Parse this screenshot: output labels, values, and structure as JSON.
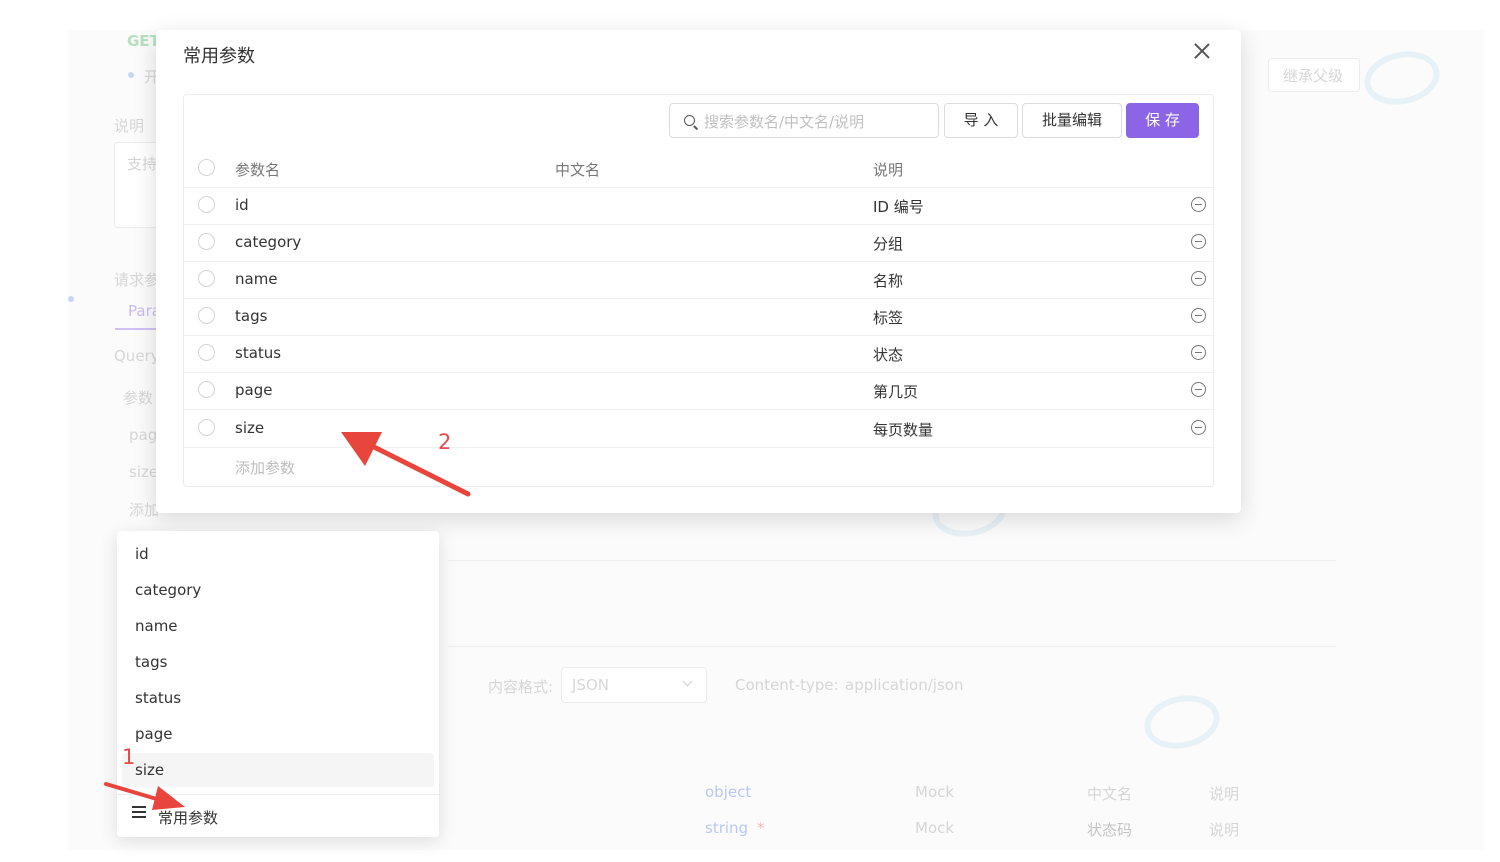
{
  "background": {
    "method": "GET",
    "status_text": "开",
    "description_label": "说明",
    "description_placeholder": "支持",
    "inherit_label": "继承父级",
    "request_params_label": "请求参",
    "params_tab": "Para",
    "query_label": "Query",
    "param_label": "参数",
    "rows": [
      "pag",
      "size",
      "添加"
    ],
    "content_format_label": "内容格式:",
    "content_format_value": "JSON",
    "content_type_label": "Content-type:",
    "content_type_value": "application/json",
    "schema_rows": [
      {
        "type": "object",
        "mock": "Mock",
        "cn": "中文名",
        "desc": "说明"
      },
      {
        "type": "string",
        "required": "*",
        "mock": "Mock",
        "cn": "状态码",
        "desc": "说明"
      }
    ]
  },
  "modal": {
    "title": "常用参数",
    "search_placeholder": "搜索参数名/中文名/说明",
    "import_label": "导 入",
    "batch_edit_label": "批量编辑",
    "save_label": "保 存",
    "columns": {
      "name": "参数名",
      "cn_name": "中文名",
      "description": "说明"
    },
    "rows": [
      {
        "name": "id",
        "cn_name": "",
        "description": "ID 编号"
      },
      {
        "name": "category",
        "cn_name": "",
        "description": "分组"
      },
      {
        "name": "name",
        "cn_name": "",
        "description": "名称"
      },
      {
        "name": "tags",
        "cn_name": "",
        "description": "标签"
      },
      {
        "name": "status",
        "cn_name": "",
        "description": "状态"
      },
      {
        "name": "page",
        "cn_name": "",
        "description": "第几页"
      },
      {
        "name": "size",
        "cn_name": "",
        "description": "每页数量"
      }
    ],
    "add_param_label": "添加参数"
  },
  "dropdown": {
    "items": [
      "id",
      "category",
      "name",
      "tags",
      "status",
      "page",
      "size"
    ],
    "hovered_item": "size",
    "footer_label": "常用参数"
  },
  "annotations": {
    "step1": "1",
    "step2": "2",
    "color": "#e54b4b"
  },
  "colors": {
    "accent": "#8c64e6"
  }
}
